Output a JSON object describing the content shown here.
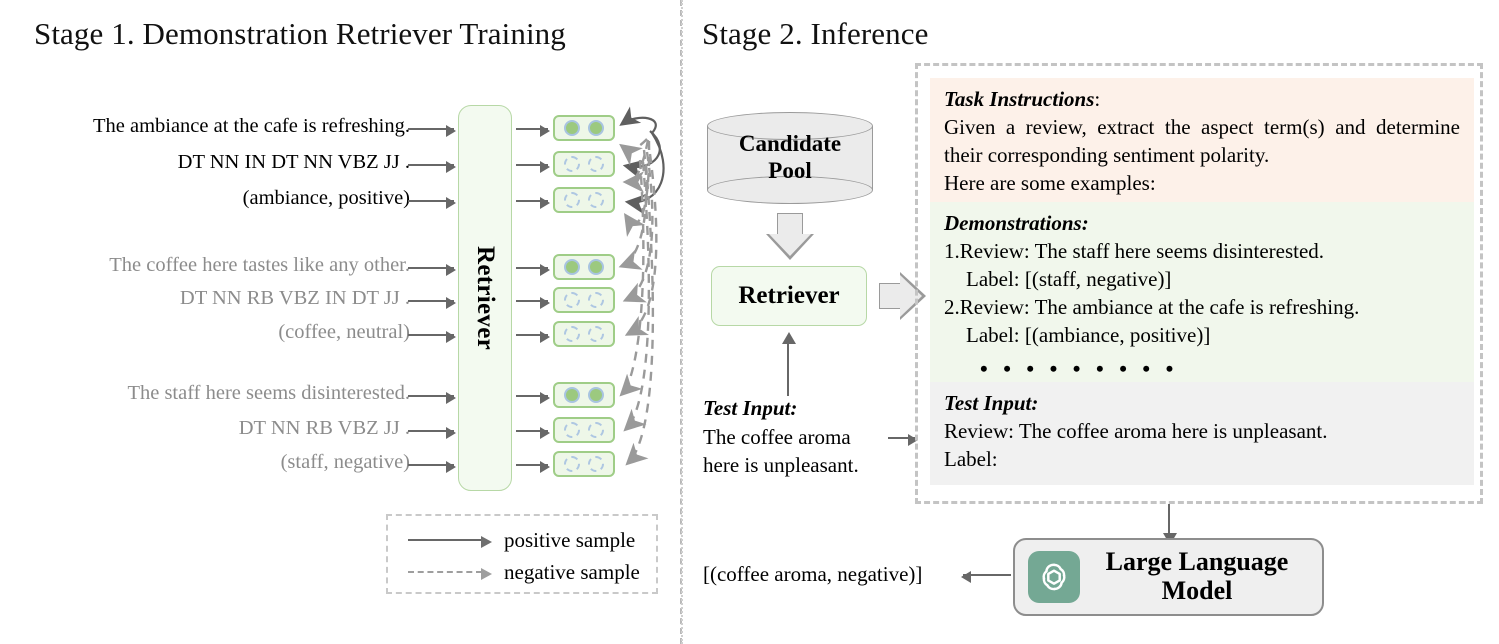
{
  "stage1": {
    "title": "Stage 1. Demonstration Retriever Training",
    "retriever_label": "Retriever",
    "groups": [
      {
        "tone": "black",
        "lines": [
          "The ambiance at the cafe is refreshing.",
          "DT NN IN DT NN VBZ JJ .",
          "(ambiance, positive)"
        ]
      },
      {
        "tone": "gray",
        "lines": [
          "The coffee here tastes like any other.",
          "DT NN RB VBZ IN DT JJ .",
          "(coffee, neutral)"
        ]
      },
      {
        "tone": "gray",
        "lines": [
          "The staff here seems disinterested.",
          "DT NN RB VBZ JJ .",
          "(staff, negative)"
        ]
      }
    ],
    "legend": {
      "positive": "positive sample",
      "negative": "negative sample"
    }
  },
  "stage2": {
    "title": "Stage 2. Inference",
    "candidate_pool": "Candidate\nPool",
    "candidate_pool_line1": "Candidate",
    "candidate_pool_line2": "Pool",
    "retriever_label": "Retriever",
    "test_input_label": "Test Input:",
    "test_input_text": "The coffee aroma here is unpleasant.",
    "prompt": {
      "task": {
        "heading": "Task Instructions",
        "heading_suffix": ":",
        "body_line1": "Given a review, extract the aspect term(s) and determine their corresponding sentiment polarity.",
        "body_line2": "Here are some examples:"
      },
      "demonstrations": {
        "heading": "Demonstrations:",
        "items": [
          {
            "review": "1.Review: The staff here seems disinterested.",
            "label": "Label: [(staff, negative)]"
          },
          {
            "review": "2.Review: The ambiance at the cafe is refreshing.",
            "label": "Label: [(ambiance, positive)]"
          }
        ],
        "ellipsis": "• • • • • • • • •"
      },
      "test": {
        "heading": "Test Input:",
        "review": "Review: The coffee aroma here is unpleasant.",
        "label": "Label:"
      }
    },
    "llm": {
      "label_line1": "Large Language",
      "label_line2": "Model",
      "icon": "openai-logo-icon",
      "icon_color": "#74a894"
    },
    "output": "[(coffee aroma, negative)]"
  },
  "colors": {
    "green_border": "#9fcd87",
    "green_fill": "#eef7e8",
    "retriever_fill": "#f3faf0",
    "task_bg": "#fdf1e9",
    "demo_bg": "#f1f7ec",
    "test_bg": "#f1f1f1",
    "arrow": "#676767",
    "gray_text": "#8c8c8c",
    "llm_icon": "#74a894"
  }
}
